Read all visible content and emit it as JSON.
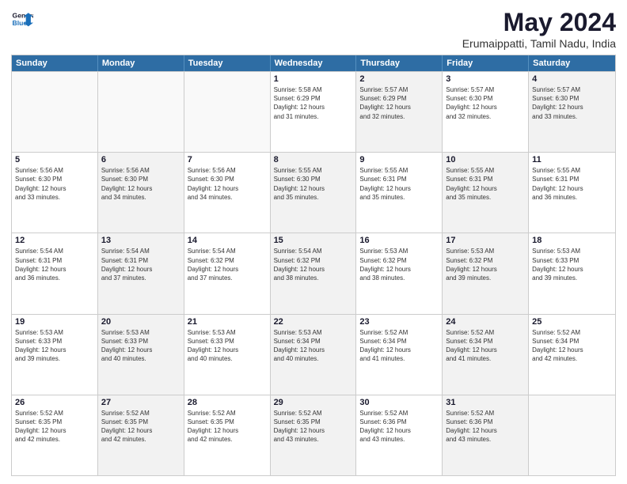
{
  "logo": {
    "line1": "General",
    "line2": "Blue"
  },
  "title": "May 2024",
  "location": "Erumaippatti, Tamil Nadu, India",
  "days_of_week": [
    "Sunday",
    "Monday",
    "Tuesday",
    "Wednesday",
    "Thursday",
    "Friday",
    "Saturday"
  ],
  "weeks": [
    [
      {
        "day": "",
        "info": "",
        "shaded": false,
        "empty": true
      },
      {
        "day": "",
        "info": "",
        "shaded": false,
        "empty": true
      },
      {
        "day": "",
        "info": "",
        "shaded": false,
        "empty": true
      },
      {
        "day": "1",
        "info": "Sunrise: 5:58 AM\nSunset: 6:29 PM\nDaylight: 12 hours\nand 31 minutes.",
        "shaded": false,
        "empty": false
      },
      {
        "day": "2",
        "info": "Sunrise: 5:57 AM\nSunset: 6:29 PM\nDaylight: 12 hours\nand 32 minutes.",
        "shaded": true,
        "empty": false
      },
      {
        "day": "3",
        "info": "Sunrise: 5:57 AM\nSunset: 6:30 PM\nDaylight: 12 hours\nand 32 minutes.",
        "shaded": false,
        "empty": false
      },
      {
        "day": "4",
        "info": "Sunrise: 5:57 AM\nSunset: 6:30 PM\nDaylight: 12 hours\nand 33 minutes.",
        "shaded": true,
        "empty": false
      }
    ],
    [
      {
        "day": "5",
        "info": "Sunrise: 5:56 AM\nSunset: 6:30 PM\nDaylight: 12 hours\nand 33 minutes.",
        "shaded": false,
        "empty": false
      },
      {
        "day": "6",
        "info": "Sunrise: 5:56 AM\nSunset: 6:30 PM\nDaylight: 12 hours\nand 34 minutes.",
        "shaded": true,
        "empty": false
      },
      {
        "day": "7",
        "info": "Sunrise: 5:56 AM\nSunset: 6:30 PM\nDaylight: 12 hours\nand 34 minutes.",
        "shaded": false,
        "empty": false
      },
      {
        "day": "8",
        "info": "Sunrise: 5:55 AM\nSunset: 6:30 PM\nDaylight: 12 hours\nand 35 minutes.",
        "shaded": true,
        "empty": false
      },
      {
        "day": "9",
        "info": "Sunrise: 5:55 AM\nSunset: 6:31 PM\nDaylight: 12 hours\nand 35 minutes.",
        "shaded": false,
        "empty": false
      },
      {
        "day": "10",
        "info": "Sunrise: 5:55 AM\nSunset: 6:31 PM\nDaylight: 12 hours\nand 35 minutes.",
        "shaded": true,
        "empty": false
      },
      {
        "day": "11",
        "info": "Sunrise: 5:55 AM\nSunset: 6:31 PM\nDaylight: 12 hours\nand 36 minutes.",
        "shaded": false,
        "empty": false
      }
    ],
    [
      {
        "day": "12",
        "info": "Sunrise: 5:54 AM\nSunset: 6:31 PM\nDaylight: 12 hours\nand 36 minutes.",
        "shaded": false,
        "empty": false
      },
      {
        "day": "13",
        "info": "Sunrise: 5:54 AM\nSunset: 6:31 PM\nDaylight: 12 hours\nand 37 minutes.",
        "shaded": true,
        "empty": false
      },
      {
        "day": "14",
        "info": "Sunrise: 5:54 AM\nSunset: 6:32 PM\nDaylight: 12 hours\nand 37 minutes.",
        "shaded": false,
        "empty": false
      },
      {
        "day": "15",
        "info": "Sunrise: 5:54 AM\nSunset: 6:32 PM\nDaylight: 12 hours\nand 38 minutes.",
        "shaded": true,
        "empty": false
      },
      {
        "day": "16",
        "info": "Sunrise: 5:53 AM\nSunset: 6:32 PM\nDaylight: 12 hours\nand 38 minutes.",
        "shaded": false,
        "empty": false
      },
      {
        "day": "17",
        "info": "Sunrise: 5:53 AM\nSunset: 6:32 PM\nDaylight: 12 hours\nand 39 minutes.",
        "shaded": true,
        "empty": false
      },
      {
        "day": "18",
        "info": "Sunrise: 5:53 AM\nSunset: 6:33 PM\nDaylight: 12 hours\nand 39 minutes.",
        "shaded": false,
        "empty": false
      }
    ],
    [
      {
        "day": "19",
        "info": "Sunrise: 5:53 AM\nSunset: 6:33 PM\nDaylight: 12 hours\nand 39 minutes.",
        "shaded": false,
        "empty": false
      },
      {
        "day": "20",
        "info": "Sunrise: 5:53 AM\nSunset: 6:33 PM\nDaylight: 12 hours\nand 40 minutes.",
        "shaded": true,
        "empty": false
      },
      {
        "day": "21",
        "info": "Sunrise: 5:53 AM\nSunset: 6:33 PM\nDaylight: 12 hours\nand 40 minutes.",
        "shaded": false,
        "empty": false
      },
      {
        "day": "22",
        "info": "Sunrise: 5:53 AM\nSunset: 6:34 PM\nDaylight: 12 hours\nand 40 minutes.",
        "shaded": true,
        "empty": false
      },
      {
        "day": "23",
        "info": "Sunrise: 5:52 AM\nSunset: 6:34 PM\nDaylight: 12 hours\nand 41 minutes.",
        "shaded": false,
        "empty": false
      },
      {
        "day": "24",
        "info": "Sunrise: 5:52 AM\nSunset: 6:34 PM\nDaylight: 12 hours\nand 41 minutes.",
        "shaded": true,
        "empty": false
      },
      {
        "day": "25",
        "info": "Sunrise: 5:52 AM\nSunset: 6:34 PM\nDaylight: 12 hours\nand 42 minutes.",
        "shaded": false,
        "empty": false
      }
    ],
    [
      {
        "day": "26",
        "info": "Sunrise: 5:52 AM\nSunset: 6:35 PM\nDaylight: 12 hours\nand 42 minutes.",
        "shaded": false,
        "empty": false
      },
      {
        "day": "27",
        "info": "Sunrise: 5:52 AM\nSunset: 6:35 PM\nDaylight: 12 hours\nand 42 minutes.",
        "shaded": true,
        "empty": false
      },
      {
        "day": "28",
        "info": "Sunrise: 5:52 AM\nSunset: 6:35 PM\nDaylight: 12 hours\nand 42 minutes.",
        "shaded": false,
        "empty": false
      },
      {
        "day": "29",
        "info": "Sunrise: 5:52 AM\nSunset: 6:35 PM\nDaylight: 12 hours\nand 43 minutes.",
        "shaded": true,
        "empty": false
      },
      {
        "day": "30",
        "info": "Sunrise: 5:52 AM\nSunset: 6:36 PM\nDaylight: 12 hours\nand 43 minutes.",
        "shaded": false,
        "empty": false
      },
      {
        "day": "31",
        "info": "Sunrise: 5:52 AM\nSunset: 6:36 PM\nDaylight: 12 hours\nand 43 minutes.",
        "shaded": true,
        "empty": false
      },
      {
        "day": "",
        "info": "",
        "shaded": false,
        "empty": true
      }
    ]
  ]
}
